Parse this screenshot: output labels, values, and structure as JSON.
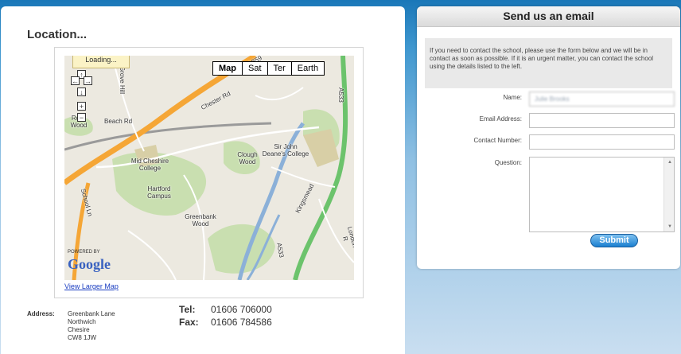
{
  "location": {
    "title": "Location...",
    "map": {
      "loading_text": "Loading...",
      "map_types": [
        "Map",
        "Sat",
        "Ter",
        "Earth"
      ],
      "selected_type": "Map",
      "places": {
        "chester_rd": "Chester Rd",
        "beach_rd": "Beach Rd",
        "mid_cheshire": "Mid Cheshire College",
        "sir_john": "Sir John Deane's College",
        "clough_wood": "Clough Wood",
        "hartford_campus": "Hartford Campus",
        "greenbank_wood": "Greenbank Wood",
        "school_ln": "School Ln",
        "kingsmead": "Kingsmead",
        "london_rd": "London R",
        "a533_top": "A533",
        "a533_bottom": "A533",
        "a559": "A559",
        "roundy_wood": "Ro   ly Wood",
        "grove_hill": "Grove Hill"
      },
      "powered_by": "POWERED BY",
      "logo_text": "Google",
      "view_larger": "View Larger Map"
    },
    "address": {
      "label": "Address:",
      "lines": [
        "Greenbank Lane",
        "Northwich",
        "Chesire",
        "CW8 1JW"
      ]
    },
    "tel": {
      "label": "Tel:",
      "value": "01606 706000"
    },
    "fax": {
      "label": "Fax:",
      "value": "01606 784586"
    }
  },
  "email": {
    "title": "Send us an email",
    "intro": "If you need to contact the school, please use the form below and we will be in contact as soon as possible. If it is an urgent matter, you can contact the school using the details listed to the left.",
    "fields": {
      "name_label": "Name:",
      "name_value": "Julie Brooks",
      "email_label": "Email Address:",
      "contact_label": "Contact Number:",
      "question_label": "Question:"
    },
    "submit": "Submit"
  }
}
